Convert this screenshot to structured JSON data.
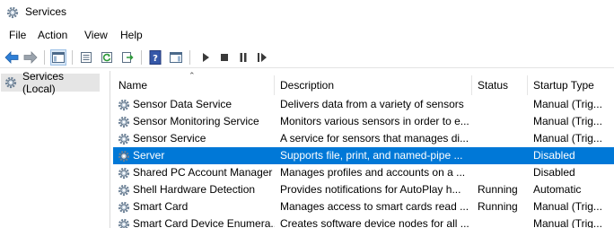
{
  "window": {
    "title": "Services"
  },
  "menu": [
    "File",
    "Action",
    "View",
    "Help"
  ],
  "toolbar": {
    "buttons": [
      "back-arrow-icon",
      "forward-arrow-icon",
      "show-hide-console-tree-icon",
      "properties-icon",
      "refresh-icon",
      "export-list-icon",
      "help-icon",
      "show-hide-action-pane-icon",
      "start-service-icon",
      "stop-service-icon",
      "pause-service-icon",
      "resume-service-icon"
    ]
  },
  "sidebar": {
    "root_label": "Services (Local)"
  },
  "columns": {
    "name": "Name",
    "description": "Description",
    "status": "Status",
    "startup": "Startup Type"
  },
  "sort": {
    "column": "Name",
    "direction": "ascending"
  },
  "services": [
    {
      "name": "Sensor Data Service",
      "description": "Delivers data from a variety of sensors",
      "status": "",
      "startup": "Manual (Trig..."
    },
    {
      "name": "Sensor Monitoring Service",
      "description": "Monitors various sensors in order to e...",
      "status": "",
      "startup": "Manual (Trig..."
    },
    {
      "name": "Sensor Service",
      "description": "A service for sensors that manages di...",
      "status": "",
      "startup": "Manual (Trig..."
    },
    {
      "name": "Server",
      "description": "Supports file, print, and named-pipe ...",
      "status": "",
      "startup": "Disabled",
      "selected": true
    },
    {
      "name": "Shared PC Account Manager",
      "description": "Manages profiles and accounts on a ...",
      "status": "",
      "startup": "Disabled"
    },
    {
      "name": "Shell Hardware Detection",
      "description": "Provides notifications for AutoPlay h...",
      "status": "Running",
      "startup": "Automatic"
    },
    {
      "name": "Smart Card",
      "description": "Manages access to smart cards read ...",
      "status": "Running",
      "startup": "Manual (Trig..."
    },
    {
      "name": "Smart Card Device Enumera...",
      "description": "Creates software device nodes for all ...",
      "status": "",
      "startup": "Manual (Trig..."
    }
  ],
  "colors": {
    "selection": "#0078d7",
    "accent_blue": "#2b6cb0"
  }
}
